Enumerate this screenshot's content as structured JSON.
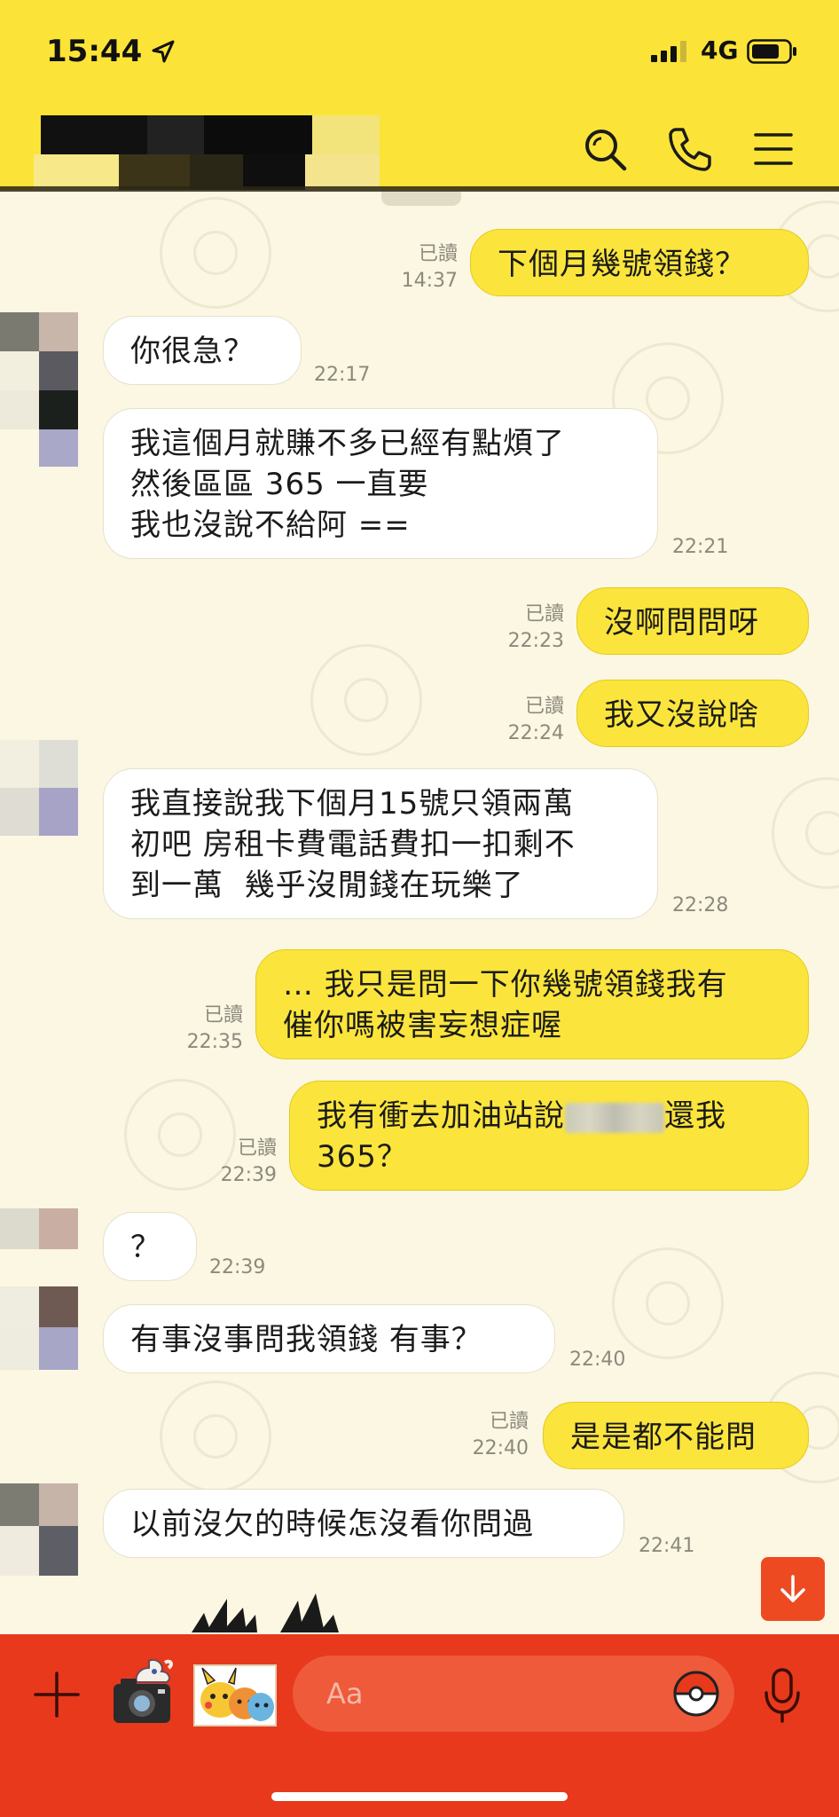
{
  "status_bar": {
    "time": "15:44",
    "network": "4G"
  },
  "header": {
    "contact_name": "",
    "icons": [
      "search-icon",
      "phone-icon",
      "menu-icon"
    ]
  },
  "messages": [
    {
      "side": "out",
      "text": "下個月幾號領錢？",
      "read": "已讀",
      "time": "14:37"
    },
    {
      "side": "in",
      "text": "你很急？",
      "time": "22:17"
    },
    {
      "side": "in",
      "text": "我這個月就賺不多已經有點煩了\n然後區區 365 一直要\n我也沒說不給阿 ==",
      "time": "22:21"
    },
    {
      "side": "out",
      "text": "沒啊問問呀",
      "read": "已讀",
      "time": "22:23"
    },
    {
      "side": "out",
      "text": "我又沒說啥",
      "read": "已讀",
      "time": "22:24"
    },
    {
      "side": "in",
      "text": "我直接說我下個月15號只領兩萬\n初吧 房租卡費電話費扣一扣剩不\n到一萬  幾乎沒閒錢在玩樂了",
      "time": "22:28"
    },
    {
      "side": "out",
      "text": "… 我只是問一下你幾號領錢我有\n催你嗎被害妄想症喔",
      "read": "已讀",
      "time": "22:35"
    },
    {
      "side": "out",
      "text_before": "我有衝去加油站說",
      "text_after": "還我\n365？",
      "read": "已讀",
      "time": "22:39"
    },
    {
      "side": "in",
      "text": "？",
      "time": "22:39"
    },
    {
      "side": "in",
      "text": "有事沒事問我領錢 有事？",
      "time": "22:40"
    },
    {
      "side": "out",
      "text": "是是都不能問",
      "read": "已讀",
      "time": "22:40"
    },
    {
      "side": "in",
      "text": "以前沒欠的時候怎沒看你問過",
      "time": "22:41"
    }
  ],
  "input": {
    "placeholder": "Aa"
  },
  "colors": {
    "header_bg": "#fbe437",
    "chat_bg": "#fbf7e2",
    "outgoing_bubble": "#fbe53c",
    "incoming_bubble": "#ffffff",
    "input_bar_bg": "#e8391d"
  }
}
